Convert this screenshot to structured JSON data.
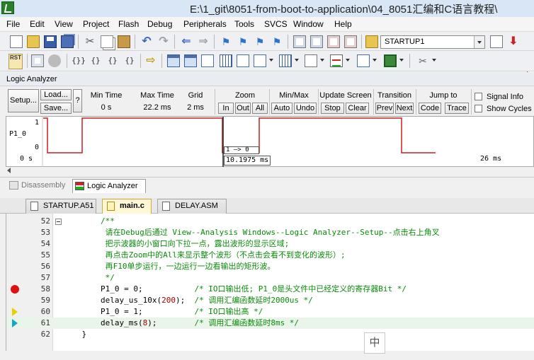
{
  "window": {
    "title": "E:\\1_git\\8051-from-boot-to-application\\04_8051汇编和C语言教程\\"
  },
  "menu": [
    "File",
    "Edit",
    "View",
    "Project",
    "Flash",
    "Debug",
    "Peripherals",
    "Tools",
    "SVCS",
    "Window",
    "Help"
  ],
  "toolbar": {
    "target": "STARTUP1",
    "rst_label": "RST"
  },
  "logic_analyzer": {
    "panel_title": "Logic Analyzer",
    "setup_label": "Setup...",
    "load_label": "Load...",
    "save_label": "Save...",
    "help_label": "?",
    "min_time_label": "Min Time",
    "min_time_value": "0 s",
    "max_time_label": "Max Time",
    "max_time_value": "22.2 ms",
    "grid_label": "Grid",
    "grid_value": "2 ms",
    "zoom_label": "Zoom",
    "zoom_in": "In",
    "zoom_out": "Out",
    "zoom_all": "All",
    "minmax_label": "Min/Max",
    "auto_label": "Auto",
    "undo_label": "Undo",
    "update_label": "Update Screen",
    "stop_label": "Stop",
    "clear_label": "Clear",
    "transition_label": "Transition",
    "prev_label": "Prev",
    "next_label": "Next",
    "jump_label": "Jump to",
    "code_label": "Code",
    "trace_label": "Trace",
    "signal_info_label": "Signal Info",
    "show_cycles_label": "Show Cycles",
    "signal_name": "P1_0",
    "level_high": "1",
    "level_low": "0",
    "time_start": "0 s",
    "time_end": "26 ms",
    "marker": "1 —> 0",
    "cursor_time": "10.1975 ms",
    "wave_color": "#cc1f1f"
  },
  "window_tabs": {
    "disassembly": "Disassembly",
    "logic_analyzer": "Logic Analyzer"
  },
  "editor_tabs": [
    "STARTUP.A51",
    "main.c",
    "DELAY.ASM"
  ],
  "code_lines": [
    {
      "num": "52",
      "text": "        /**",
      "type": "com",
      "fold": true
    },
    {
      "num": "53",
      "text": "         请在Debug后通过 View--Analysis Windows--Logic Analyzer--Setup--点击右上角叉",
      "type": "com"
    },
    {
      "num": "54",
      "text": "         把示波器的小窗口向下拉一点，露出波形的显示区域;",
      "type": "com"
    },
    {
      "num": "55",
      "text": "         再点击Zoom中的All来显示整个波形（不点击会看不到变化的波形）;",
      "type": "com"
    },
    {
      "num": "56",
      "text": "         再F10单步运行，一边运行一边看输出的矩形波。",
      "type": "com"
    },
    {
      "num": "57",
      "text": "         */",
      "type": "com"
    },
    {
      "num": "58",
      "code": "        P1_0 = 0;           ",
      "comment": "/* IO口输出低; P1_0是头文件中已经定义的寄存器Bit */",
      "mark": "bp"
    },
    {
      "num": "59",
      "code": "        delay_us_10x(200);  ",
      "comment": "/* 调用汇编函数延时2000us */"
    },
    {
      "num": "60",
      "code": "        P1_0 = 1;           ",
      "comment": "/* IO口输出高 */",
      "mark": "yellow"
    },
    {
      "num": "61",
      "code": "        delay_ms(8);        ",
      "comment": "/* 调用汇编函数延时8ms */",
      "mark": "cyan",
      "current": true
    },
    {
      "num": "62",
      "code": "    }",
      "comment": ""
    }
  ],
  "ime_label": "中"
}
